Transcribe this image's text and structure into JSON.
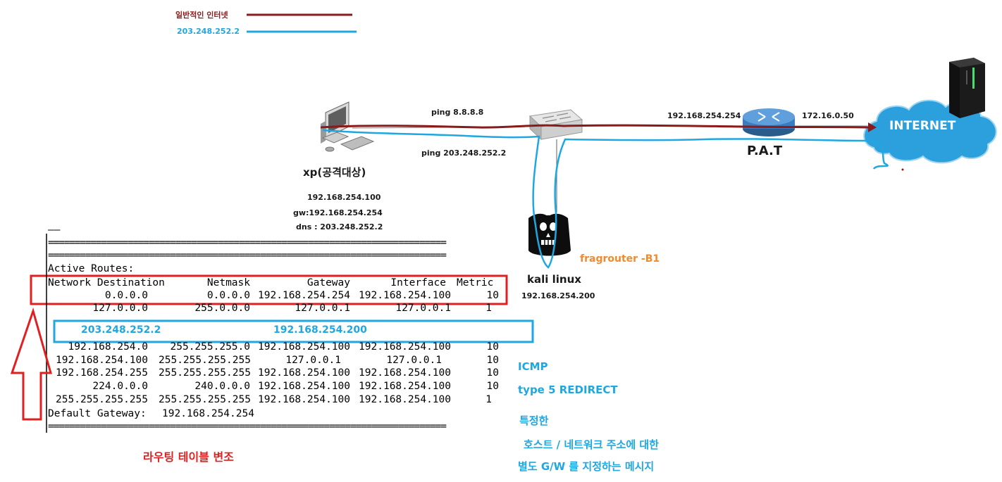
{
  "legend": {
    "normal_label": "일반적인 인터넷",
    "normal_color": "#8b1a1a",
    "attack_label": "203.248.252.2",
    "attack_color": "#1ea7e1"
  },
  "nodes": {
    "xp": {
      "title": "xp(공격대상)",
      "ip": "192.168.254.100",
      "gw": "gw:192.168.254.254",
      "dns": "dns : 203.248.252.2"
    },
    "kali": {
      "title": "kali linux",
      "ip": "192.168.254.200",
      "tool": "fragrouter -B1"
    },
    "router": {
      "title": "P.A.T",
      "inner_ip": "192.168.254.254",
      "outer_ip": "172.16.0.50"
    },
    "internet": {
      "label": "INTERNET"
    }
  },
  "links": {
    "ping_normal": "ping 8.8.8.8",
    "ping_attack": "ping 203.248.252.2"
  },
  "route_table": {
    "top_marks": "——",
    "separator": "===========================================================================",
    "title": "Active Routes:",
    "headers": [
      "Network Destination",
      "Netmask",
      "Gateway",
      "Interface",
      "Metric"
    ],
    "rows_top": [
      [
        "0.0.0.0",
        "0.0.0.0",
        "192.168.254.254",
        "192.168.254.100",
        "10"
      ],
      [
        "127.0.0.0",
        "255.0.0.0",
        "127.0.0.1",
        "127.0.0.1",
        "1"
      ]
    ],
    "injected": {
      "destination": "203.248.252.2",
      "gateway": "192.168.254.200"
    },
    "rows_bottom": [
      [
        "192.168.254.0",
        "255.255.255.0",
        "192.168.254.100",
        "192.168.254.100",
        "10"
      ],
      [
        "192.168.254.100",
        "255.255.255.255",
        "127.0.0.1",
        "127.0.0.1",
        "10"
      ],
      [
        "192.168.254.255",
        "255.255.255.255",
        "192.168.254.100",
        "192.168.254.100",
        "10"
      ],
      [
        "224.0.0.0",
        "240.0.0.0",
        "192.168.254.100",
        "192.168.254.100",
        "10"
      ],
      [
        "255.255.255.255",
        "255.255.255.255",
        "192.168.254.100",
        "192.168.254.100",
        "1"
      ]
    ],
    "default_gateway_label": "Default Gateway:",
    "default_gateway_value": "192.168.254.254"
  },
  "caption_route": "라우팅 테이블 변조",
  "notes": {
    "line1": "ICMP",
    "line2": "type 5 REDIRECT",
    "line3": "특정한",
    "line4": "호스트 /  네트워크 주소에 대한",
    "line5": "별도 G/W 를 지정하는 메시지"
  }
}
